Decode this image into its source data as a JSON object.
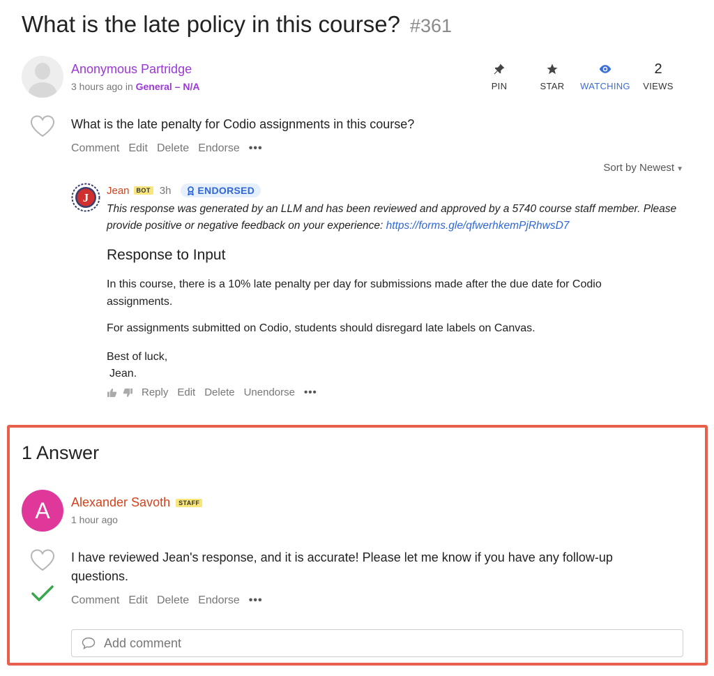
{
  "post": {
    "title": "What is the late policy in this course?",
    "number": "#361",
    "author": "Anonymous Partridge",
    "time": "3 hours ago in",
    "category": "General – N/A",
    "question": "What is the late penalty for Codio assignments in this course?",
    "actions": {
      "comment": "Comment",
      "edit": "Edit",
      "delete": "Delete",
      "endorse": "Endorse",
      "more": "•••"
    }
  },
  "stats": {
    "pin": {
      "label": "PIN",
      "icon": "pin-icon"
    },
    "star": {
      "label": "STAR",
      "icon": "star-icon"
    },
    "watching": {
      "label": "WATCHING",
      "icon": "eye-icon",
      "color": "#3a6fd8"
    },
    "views": {
      "value": "2",
      "label": "VIEWS"
    }
  },
  "sort": {
    "label": "Sort by Newest"
  },
  "followup": {
    "author": "Jean",
    "badge": "BOT",
    "time": "3h",
    "endorsed_label": "ENDORSED",
    "disclaimer": "This response was generated by an LLM and has been reviewed and approved by a 5740 course staff member. Please provide positive or negative feedback on your experience: ",
    "link": "https://forms.gle/qfwerhkemPjRhwsD7",
    "heading": "Response to Input",
    "paragraph1": "In this course, there is a 10% late penalty per day for submissions made after the due date for Codio assignments.",
    "paragraph2": "For assignments submitted on Codio, students should disregard late labels on Canvas.",
    "signoff1": "Best of luck,",
    "signoff2": "Jean.",
    "actions": {
      "reply": "Reply",
      "edit": "Edit",
      "delete": "Delete",
      "unendorse": "Unendorse",
      "more": "•••"
    }
  },
  "answers": {
    "title": "1 Answer",
    "author": "Alexander Savoth",
    "avatar_letter": "A",
    "badge": "STAFF",
    "time": "1 hour ago",
    "text": "I have reviewed Jean's response, and it is accurate! Please let me know if you have any follow-up questions.",
    "actions": {
      "comment": "Comment",
      "edit": "Edit",
      "delete": "Delete",
      "endorse": "Endorse",
      "more": "•••"
    },
    "comment_placeholder": "Add comment"
  },
  "colors": {
    "accent_purple": "#9b38d8",
    "name_red": "#d2421c",
    "highlight_border": "#e8604c",
    "avatar_pink": "#e0389a",
    "check_green": "#3aa64b"
  }
}
